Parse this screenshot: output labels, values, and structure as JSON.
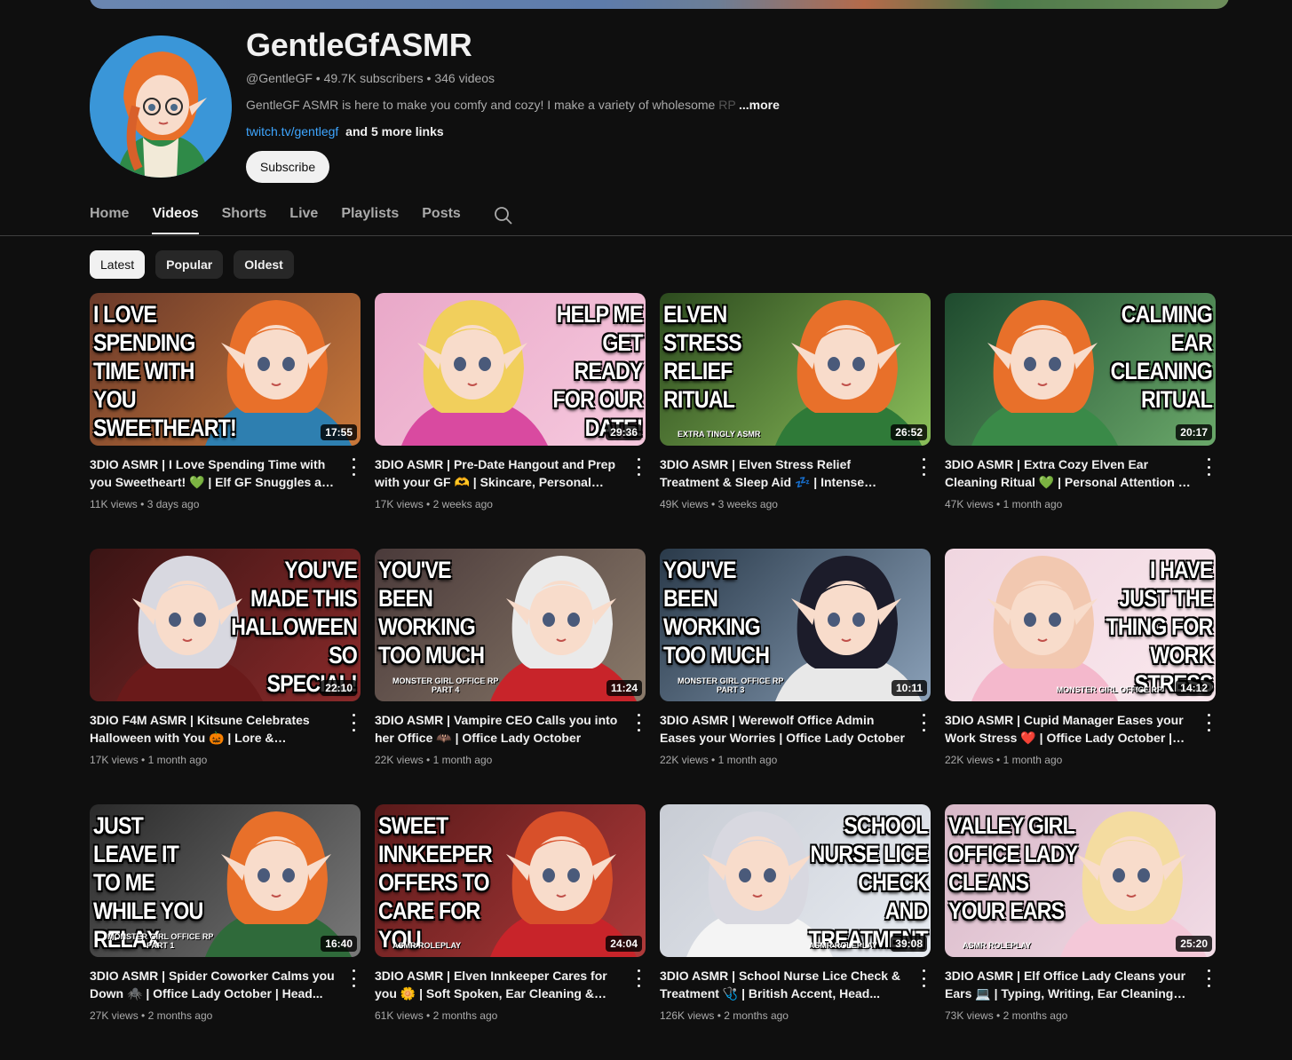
{
  "channel": {
    "name": "GentleGfASMR",
    "handle": "@GentleGF",
    "subscribers": "49.7K subscribers",
    "videos_count": "346 videos",
    "description": "GentleGF ASMR is here to make you comfy and cozy! I make a variety of wholesome",
    "description_fade": "RP",
    "more_label": "...more",
    "link_text": "twitch.tv/gentlegf",
    "more_links": "and 5 more links",
    "subscribe_label": "Subscribe",
    "meta_separator": "•"
  },
  "tabs": [
    {
      "label": "Home"
    },
    {
      "label": "Videos",
      "active": true
    },
    {
      "label": "Shorts"
    },
    {
      "label": "Live"
    },
    {
      "label": "Playlists"
    },
    {
      "label": "Posts"
    }
  ],
  "sort_chips": [
    {
      "label": "Latest",
      "active": true
    },
    {
      "label": "Popular"
    },
    {
      "label": "Oldest"
    }
  ],
  "videos": [
    {
      "thumb_text": "I LOVE\nSPENDING\nTIME WITH\nYOU\nSWEETHEART!",
      "thumb_side": "left",
      "thumb_sub": "",
      "duration": "17:55",
      "title": "3DIO ASMR | I Love Spending Time with you Sweetheart! 💚 | Elf GF Snuggles and Word...",
      "views": "11K views",
      "age": "3 days ago",
      "colors": {
        "bg1": "#6b3a2a",
        "bg2": "#c9783a",
        "hair": "#e8702a",
        "cloth": "#2e7fb0"
      }
    },
    {
      "thumb_text": "HELP ME\nGET\nREADY\nFOR OUR\nDATE!",
      "thumb_side": "right",
      "thumb_sub": "",
      "duration": "29:36",
      "title": "3DIO ASMR | Pre-Date Hangout and Prep with your GF 🫶 | Skincare, Personal Attenti...",
      "views": "17K views",
      "age": "2 weeks ago",
      "colors": {
        "bg1": "#e9a8c8",
        "bg2": "#f6c9de",
        "hair": "#f1cf5c",
        "cloth": "#d94aa0"
      }
    },
    {
      "thumb_text": "ELVEN\nSTRESS\nRELIEF\nRITUAL",
      "thumb_side": "left",
      "thumb_sub": "EXTRA TINGLY ASMR",
      "duration": "26:52",
      "title": "3DIO ASMR | Elven Stress Relief Treatment & Sleep Aid 💤 | Intense Triggers &...",
      "views": "49K views",
      "age": "3 weeks ago",
      "colors": {
        "bg1": "#2c4a1e",
        "bg2": "#8bbf5a",
        "hair": "#e8702a",
        "cloth": "#2f7a38"
      }
    },
    {
      "thumb_text": "CALMING\nEAR\nCLEANING\nRITUAL",
      "thumb_side": "right",
      "thumb_sub": "",
      "duration": "20:17",
      "title": "3DIO ASMR | Extra Cozy Elven Ear Cleaning Ritual 💚 | Personal Attention & Unintelligib...",
      "views": "47K views",
      "age": "1 month ago",
      "colors": {
        "bg1": "#1e4a2e",
        "bg2": "#6aa86a",
        "hair": "#e8702a",
        "cloth": "#3a8a48"
      }
    },
    {
      "thumb_text": "YOU'VE\nMADE THIS\nHALLOWEEN\nSO\nSPECIAL!",
      "thumb_side": "right",
      "thumb_sub": "",
      "duration": "22:10",
      "title": "3DIO F4M ASMR | Kitsune Celebrates Halloween with You 🎃 | Lore & Personal...",
      "views": "17K views",
      "age": "1 month ago",
      "colors": {
        "bg1": "#3a1414",
        "bg2": "#8a2a2a",
        "hair": "#d8d8e0",
        "cloth": "#6a1a1a"
      }
    },
    {
      "thumb_text": "YOU'VE\nBEEN\nWORKING\nTOO MUCH",
      "thumb_side": "left",
      "thumb_sub": "MONSTER GIRL OFFICE RP\nPART 4",
      "duration": "11:24",
      "title": "3DIO ASMR | Vampire CEO Calls you into her Office 🦇 | Office Lady October",
      "views": "22K views",
      "age": "1 month ago",
      "colors": {
        "bg1": "#4a3a3a",
        "bg2": "#8a7a6a",
        "hair": "#eaeaea",
        "cloth": "#c8242a"
      }
    },
    {
      "thumb_text": "YOU'VE\nBEEN\nWORKING\nTOO MUCH",
      "thumb_side": "left",
      "thumb_sub": "MONSTER GIRL OFFICE RP\nPART 3",
      "duration": "10:11",
      "title": "3DIO ASMR | Werewolf Office Admin Eases your Worries | Office Lady October",
      "views": "22K views",
      "age": "1 month ago",
      "colors": {
        "bg1": "#2a3a4a",
        "bg2": "#8aa0b8",
        "hair": "#1c1c2a",
        "cloth": "#e8e8e8"
      }
    },
    {
      "thumb_text": "I HAVE\nJUST THE\nTHING FOR\nWORK\nSTRESS",
      "thumb_side": "right",
      "thumb_sub": "MONSTER GIRL OFFICE RP",
      "duration": "14:12",
      "title": "3DIO ASMR | Cupid Manager Eases your Work Stress ❤️ | Office Lady October | Ear...",
      "views": "22K views",
      "age": "1 month ago",
      "colors": {
        "bg1": "#f0d6e0",
        "bg2": "#fae8ee",
        "hair": "#f2c8b0",
        "cloth": "#f4b8cc"
      }
    },
    {
      "thumb_text": "JUST\nLEAVE IT\nTO ME\nWHILE YOU\nRELAX",
      "thumb_side": "left",
      "thumb_sub": "MONSTER GIRL OFFICE RP\nPART 1",
      "duration": "16:40",
      "title": "3DIO ASMR | Spider Coworker Calms you Down 🕷️ | Office Lady October | Head...",
      "views": "27K views",
      "age": "2 months ago",
      "colors": {
        "bg1": "#2a2a2a",
        "bg2": "#7a7a7a",
        "hair": "#e8702a",
        "cloth": "#2f6a3a"
      }
    },
    {
      "thumb_text": "SWEET\nINNKEEPER\nOFFERS TO\nCARE FOR\nYOU",
      "thumb_side": "left",
      "thumb_sub": "ASMR ROLEPLAY",
      "duration": "24:04",
      "title": "3DIO ASMR | Elven Innkeeper Cares for you 🌼 | Soft Spoken, Ear Cleaning & Hair...",
      "views": "61K views",
      "age": "2 months ago",
      "colors": {
        "bg1": "#5a1a1a",
        "bg2": "#b03a3a",
        "hair": "#d8502a",
        "cloth": "#c8242a"
      }
    },
    {
      "thumb_text": "SCHOOL\nNURSE LICE\nCHECK\nAND\nTREATMENT",
      "thumb_side": "right",
      "thumb_sub": "ASMR ROLEPLAY",
      "duration": "39:08",
      "title": "3DIO ASMR | School Nurse Lice Check & Treatment 🩺 | British Accent, Head...",
      "views": "126K views",
      "age": "2 months ago",
      "colors": {
        "bg1": "#c8ccd4",
        "bg2": "#e8ecf2",
        "hair": "#d8d8e0",
        "cloth": "#f4f4f4"
      }
    },
    {
      "thumb_text": "VALLEY GIRL\nOFFICE LADY\nCLEANS\nYOUR EARS",
      "thumb_side": "left",
      "thumb_sub": "ASMR ROLEPLAY",
      "duration": "25:20",
      "title": "3DIO ASMR | Elf Office Lady Cleans your Ears 💻 | Typing, Writing, Ear Cleaning &...",
      "views": "73K views",
      "age": "2 months ago",
      "colors": {
        "bg1": "#d8b8c8",
        "bg2": "#f2dce6",
        "hair": "#f4dca0",
        "cloth": "#f4c8d8"
      }
    }
  ],
  "icons": {
    "search": "search-icon",
    "more": "more-vert-icon"
  },
  "accent": {
    "link": "#3ea6ff",
    "background": "#0f0f0f",
    "secondary_text": "#aaaaaa"
  }
}
